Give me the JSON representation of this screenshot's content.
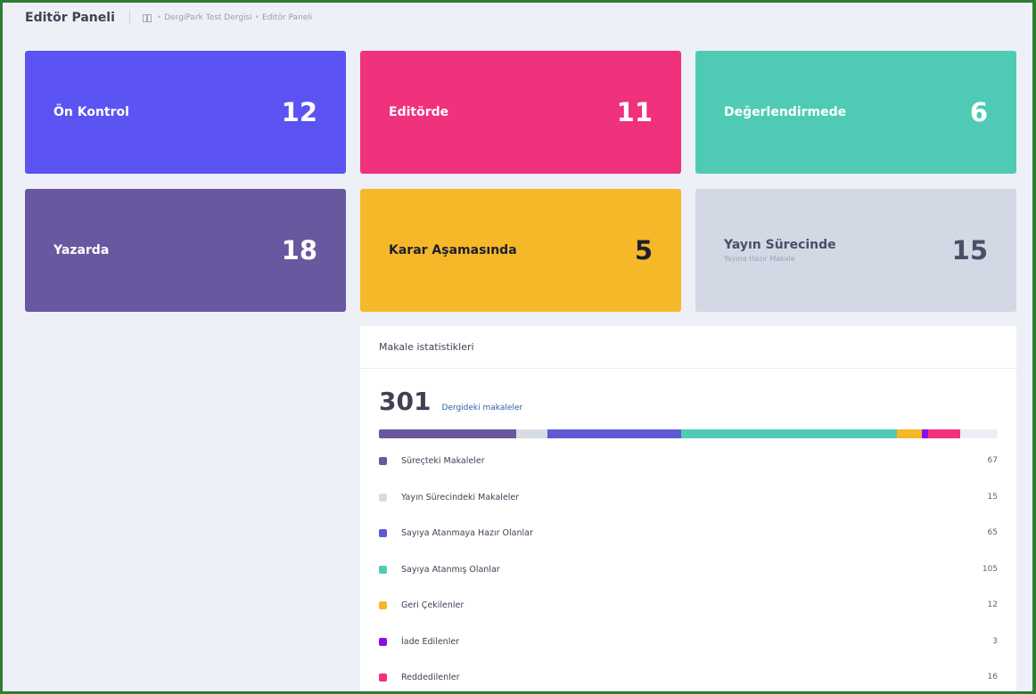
{
  "header": {
    "title": "Editör Paneli",
    "breadcrumb": [
      "DergiPark Test Dergisi",
      "Editör Paneli"
    ]
  },
  "cards": [
    {
      "label": "Ön Kontrol",
      "count": "12",
      "color": "#5b53f2"
    },
    {
      "label": "Editörde",
      "count": "11",
      "color": "#f0317d"
    },
    {
      "label": "Değerlendirmede",
      "count": "6",
      "color": "#4fcbb5"
    },
    {
      "label": "Yazarda",
      "count": "18",
      "color": "#69589f"
    },
    {
      "label": "Karar Aşamasında",
      "count": "5",
      "color": "#f5b829"
    },
    {
      "label": "Yayın Sürecinde",
      "sublabel": "Yayına Hazır Makale",
      "count": "15",
      "color": "#d2d8e4"
    }
  ],
  "stats": {
    "title": "Makale istatistikleri",
    "total": "301",
    "total_label": "Dergideki makaleler",
    "items": [
      {
        "label": "Süreçteki Makaleler",
        "value": 67,
        "color": "#69589f"
      },
      {
        "label": "Yayın Sürecindeki Makaleler",
        "value": 15,
        "color": "#d6dbe5"
      },
      {
        "label": "Sayıya Atanmaya Hazır Olanlar",
        "value": 65,
        "color": "#5f59d6"
      },
      {
        "label": "Sayıya Atanmış Olanlar",
        "value": 105,
        "color": "#4fcbb5"
      },
      {
        "label": "Geri Çekilenler",
        "value": 12,
        "color": "#f5b829"
      },
      {
        "label": "İade Edilenler",
        "value": 3,
        "color": "#8c0fe8"
      },
      {
        "label": "Reddedilenler",
        "value": 16,
        "color": "#f0317d"
      }
    ]
  }
}
